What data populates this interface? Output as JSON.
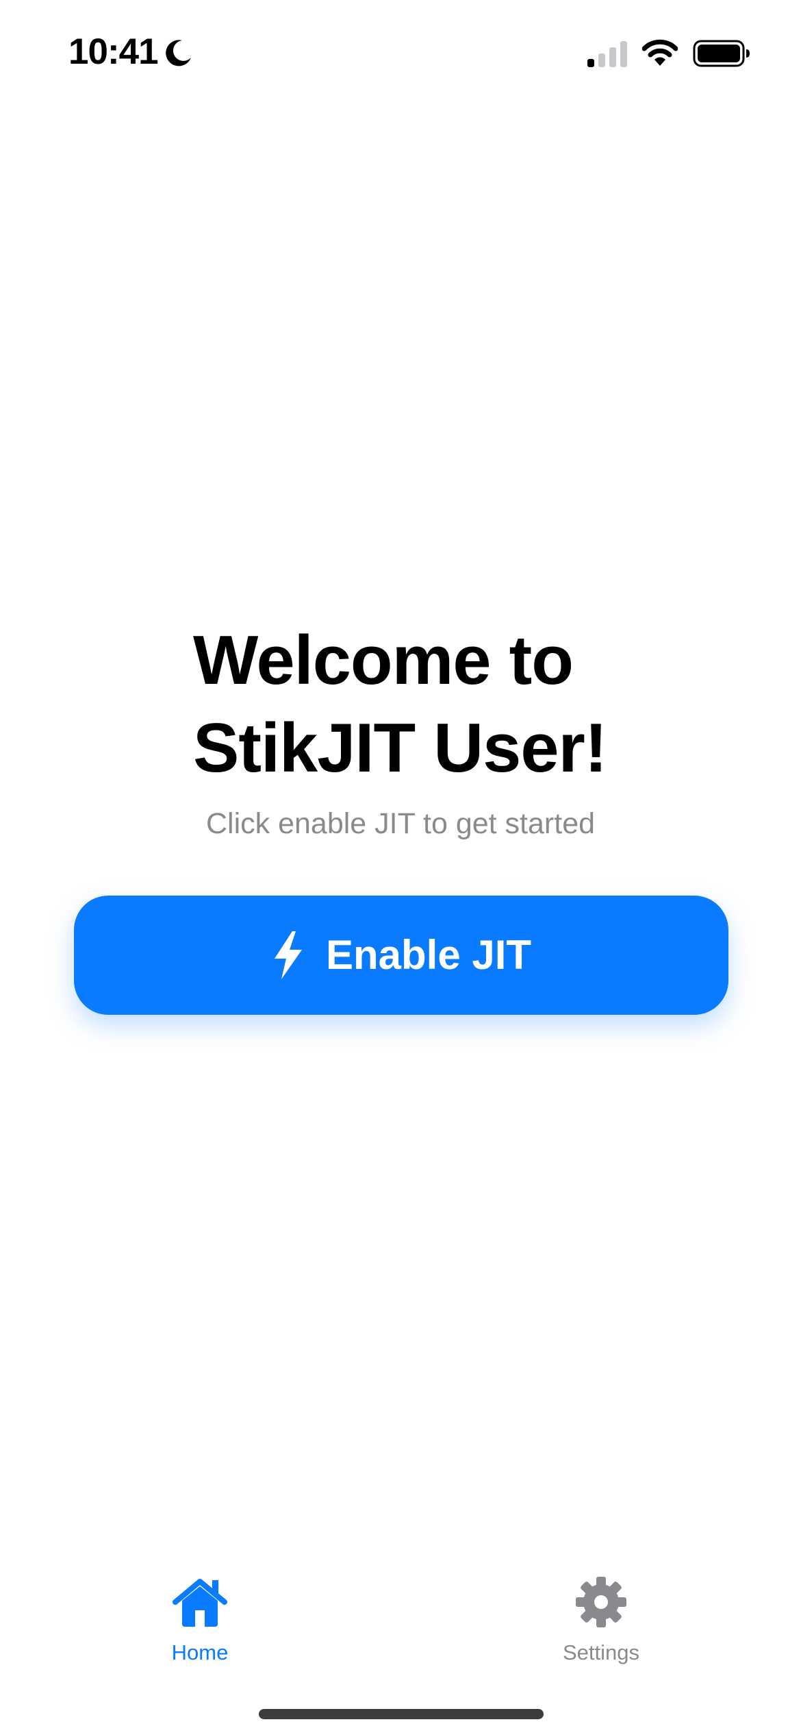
{
  "status_bar": {
    "time": "10:41",
    "icons": [
      "moon-icon",
      "signal-icon",
      "wifi-icon",
      "battery-icon"
    ]
  },
  "main": {
    "title_line1": "Welcome to",
    "title_line2": "StikJIT User!",
    "subtitle": "Click enable JIT to get started",
    "enable_button": {
      "label": "Enable JIT",
      "icon": "bolt-icon",
      "color": "#0a7aff"
    }
  },
  "tab_bar": {
    "tabs": [
      {
        "label": "Home",
        "icon": "house-icon",
        "active": true
      },
      {
        "label": "Settings",
        "icon": "gear-icon",
        "active": false
      }
    ],
    "active_color": "#0a7aff",
    "inactive_color": "#8a8a8e"
  }
}
